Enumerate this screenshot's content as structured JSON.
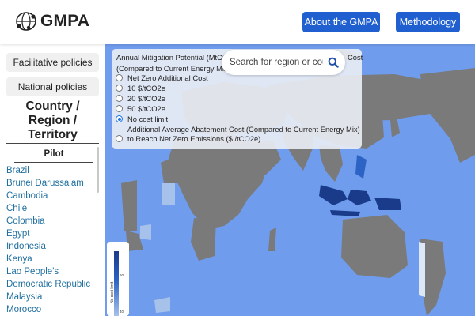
{
  "header": {
    "logo_text": "GMPA",
    "logo_icon": "globe-network-icon",
    "nav": [
      {
        "label": "About the GMPA"
      },
      {
        "label": "Methodology"
      }
    ],
    "accent_color": "#1f5fcf"
  },
  "sidebar": {
    "buttons": [
      {
        "label": "Facilitative policies"
      },
      {
        "label": "National policies"
      }
    ],
    "heading_lines": [
      "Country /",
      "Region /",
      "Territory"
    ],
    "section_label": "Pilot",
    "countries": [
      "Brazil",
      "Brunei Darussalam",
      "Cambodia",
      "Chile",
      "Colombia",
      "Egypt",
      "Indonesia",
      "Kenya",
      "Lao People's",
      "Democratic Republic",
      "Malaysia",
      "Morocco"
    ],
    "link_color": "#1f6f9f"
  },
  "overlay": {
    "title_line1": "Annual Mitigation Potential (MtCO",
    "title_line1_end": "Cost",
    "title_line2": "(Compared to Current Energy Mix)",
    "options": [
      {
        "label": "Net Zero Additional Cost",
        "selected": false
      },
      {
        "label": "10 $/tCO2e",
        "selected": false
      },
      {
        "label": "20 $/tCO2e",
        "selected": false
      },
      {
        "label": "50 $/tCO2e",
        "selected": false
      },
      {
        "label": "No cost limit",
        "selected": true
      }
    ],
    "abatement_line1": "Additional Average Abatement Cost (Compared to Current Energy Mix)",
    "abatement_line2": "to Reach Net Zero Emissions ($ /tCO2e)",
    "abatement_selected": false
  },
  "search": {
    "placeholder": "Search for region or country",
    "icon": "search-icon"
  },
  "legend": {
    "tick_top": "60",
    "tick_bottom": "40",
    "label": "No cost limit"
  },
  "map": {
    "ocean_color": "#6f9cec",
    "land_color": "#7a7a7a",
    "highlight_color": "#1a3b8a"
  }
}
